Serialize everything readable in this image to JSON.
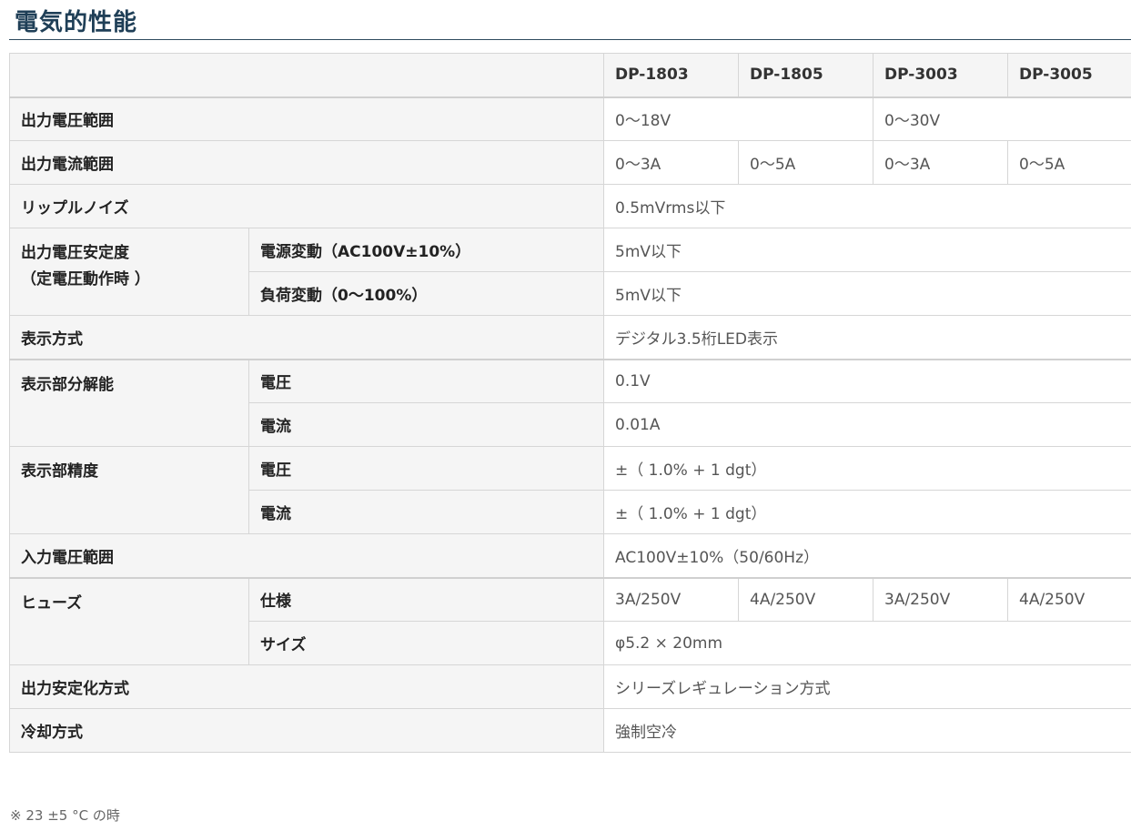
{
  "title": "電気的性能",
  "headers": [
    "DP-1803",
    "DP-1805",
    "DP-3003",
    "DP-3005"
  ],
  "rows": {
    "out_voltage": {
      "label": "出力電圧範囲",
      "v1": "0～18V",
      "v2": "0～30V"
    },
    "out_current": {
      "label": "出力電流範囲",
      "v1": "0～3A",
      "v2": "0～5A",
      "v3": "0～3A",
      "v4": "0～5A"
    },
    "ripple": {
      "label": "リップルノイズ",
      "value": "0.5mVrms以下"
    },
    "stability": {
      "label1": "出力電圧安定度",
      "label2": "（定電圧動作時 ）",
      "sub1": "電源変動（AC100V±10%）",
      "val1": "5mV以下",
      "sub2": "負荷変動（0～100%）",
      "val2": "5mV以下"
    },
    "display": {
      "label": "表示方式",
      "value": "デジタル3.5桁LED表示"
    },
    "resolution": {
      "label": "表示部分解能",
      "sub1": "電圧",
      "val1": "0.1V",
      "sub2": "電流",
      "val2": "0.01A"
    },
    "accuracy": {
      "label": "表示部精度",
      "sub1": "電圧",
      "val1": "±（ 1.0% + 1 dgt）",
      "sub2": "電流",
      "val2": "±（ 1.0% + 1 dgt）"
    },
    "input_voltage": {
      "label": "入力電圧範囲",
      "value": "AC100V±10%（50/60Hz）"
    },
    "fuse": {
      "label": "ヒューズ",
      "sub1": "仕様",
      "v1": "3A/250V",
      "v2": "4A/250V",
      "v3": "3A/250V",
      "v4": "4A/250V",
      "sub2": "サイズ",
      "size": "φ5.2 × 20mm"
    },
    "regulation": {
      "label": "出力安定化方式",
      "value": "シリーズレギュレーション方式"
    },
    "cooling": {
      "label": "冷却方式",
      "value": "強制空冷"
    }
  },
  "note": "※ 23 ±5 °C の時"
}
